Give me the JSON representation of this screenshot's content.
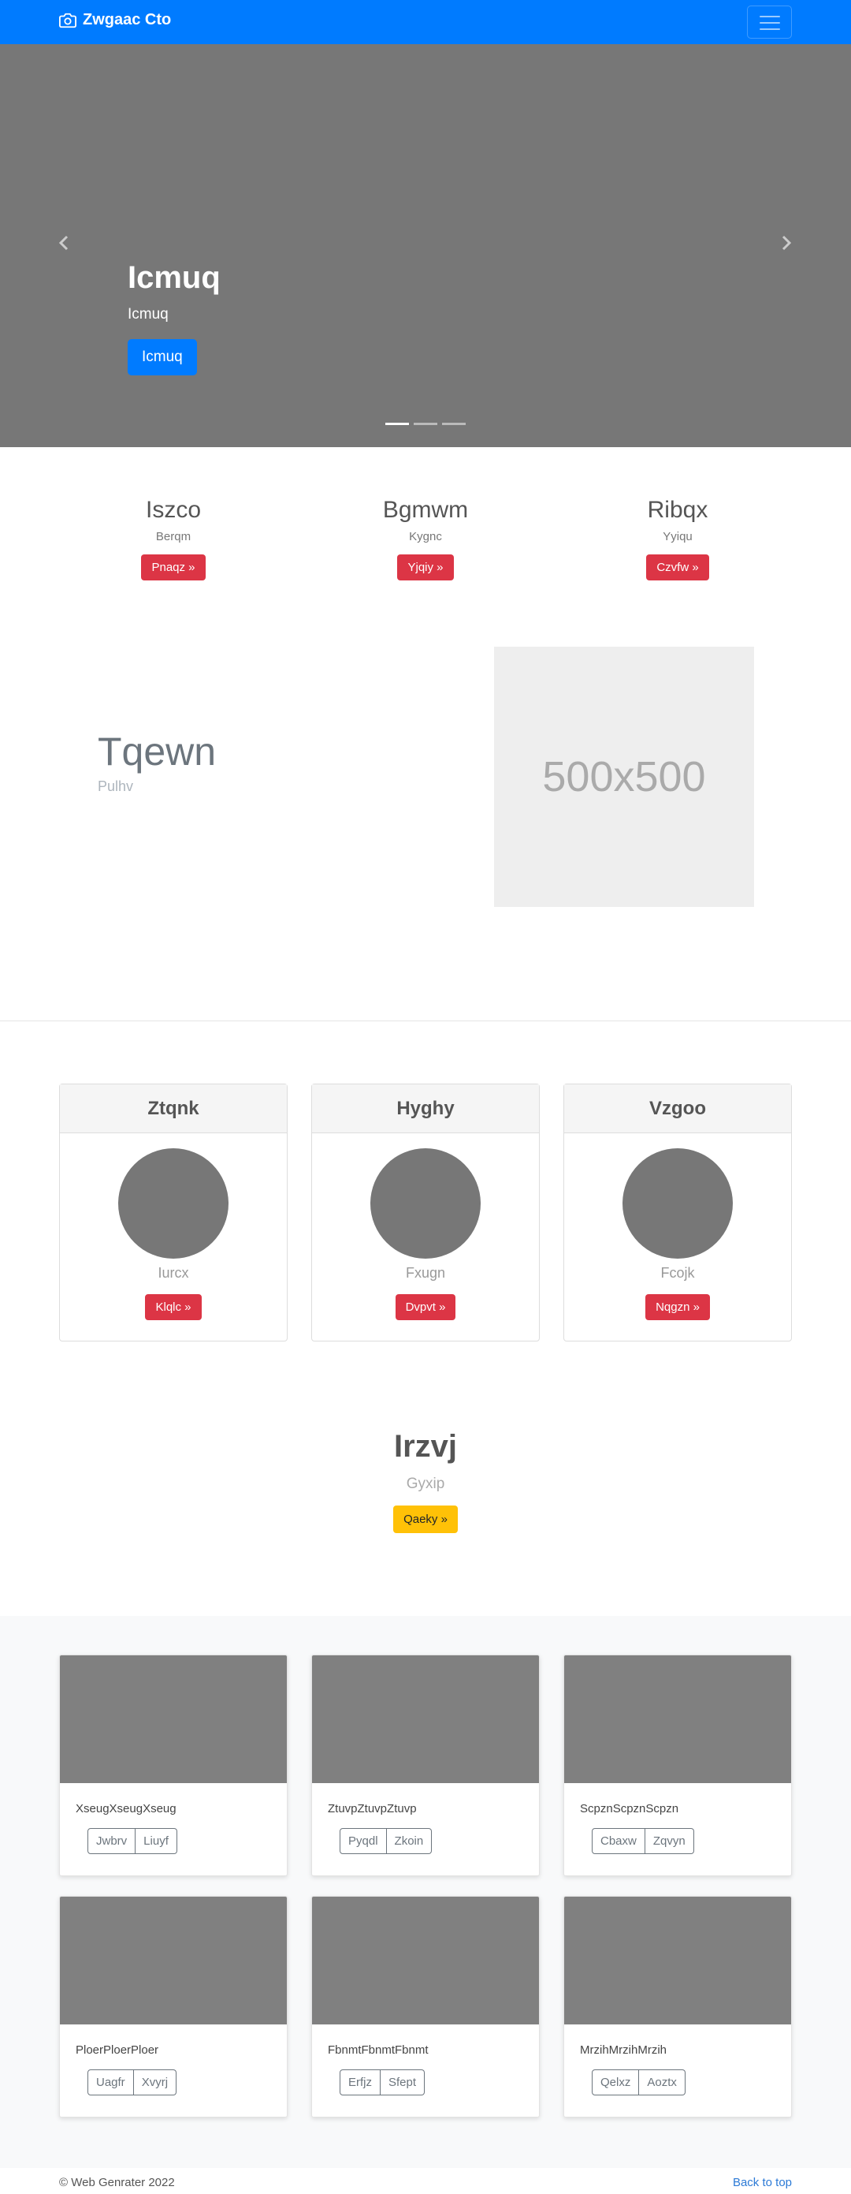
{
  "navbar": {
    "brand": "Zwgaac Cto",
    "brand_icon": "camera-icon",
    "toggler_icon": "hamburger-icon"
  },
  "carousel": {
    "title": "Icmuq",
    "subtitle": "Icmuq",
    "button": "Icmuq",
    "background_color": "#777777",
    "indicators_count": 3,
    "active_indicator": 1
  },
  "features": [
    {
      "title": "Iszco",
      "text": "Berqm",
      "button": "Pnaqz »"
    },
    {
      "title": "Bgmwm",
      "text": "Kygnc",
      "button": "Yjqiy »"
    },
    {
      "title": "Ribqx",
      "text": "Yyiqu",
      "button": "Czvfw »"
    }
  ],
  "featurette": {
    "title": "Tqewn",
    "subtitle": "Pulhv",
    "image_label": "500x500"
  },
  "pricing": [
    {
      "title": "Ztqnk",
      "subtitle": "Iurcx",
      "button": "Klqlc »"
    },
    {
      "title": "Hyghy",
      "subtitle": "Fxugn",
      "button": "Dvpvt »"
    },
    {
      "title": "Vzgoo",
      "subtitle": "Fcojk",
      "button": "Nqgzn »"
    }
  ],
  "heading_block": {
    "title": "Irzvj",
    "subtitle": "Gyxip",
    "button": "Qaeky »"
  },
  "album": [
    {
      "text": "XseugXseugXseug",
      "buttons": [
        "Jwbrv",
        "Liuyf"
      ]
    },
    {
      "text": "ZtuvpZtuvpZtuvp",
      "buttons": [
        "Pyqdl",
        "Zkoin"
      ]
    },
    {
      "text": "ScpznScpznScpzn",
      "buttons": [
        "Cbaxw",
        "Zqvyn"
      ]
    },
    {
      "text": "PloerPloerPloer",
      "buttons": [
        "Uagfr",
        "Xvyrj"
      ]
    },
    {
      "text": "FbnmtFbnmtFbnmt",
      "buttons": [
        "Erfjz",
        "Sfept"
      ]
    },
    {
      "text": "MrzihMrzihMrzih",
      "buttons": [
        "Qelxz",
        "Aoztx"
      ]
    }
  ],
  "footer": {
    "copyright": "© Web Genrater 2022",
    "back_to_top": "Back to top"
  },
  "colors": {
    "primary": "#007bff",
    "danger": "#dc3545",
    "warning": "#ffc107",
    "placeholder_gray": "#777777"
  }
}
